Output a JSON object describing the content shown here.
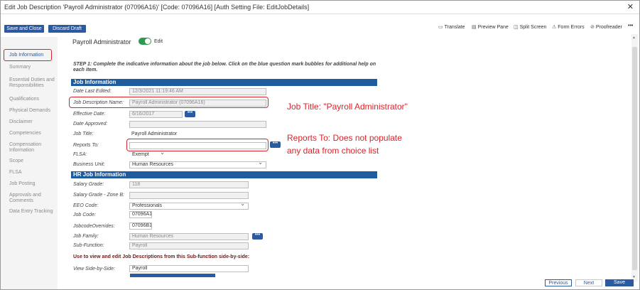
{
  "window": {
    "title": "Edit Job Description 'Payroll Administrator (07096A16)' [Code: 07096A16] [Auth Setting File: EditJobDetails]"
  },
  "toolbar": {
    "save_close": "Save and Close",
    "discard": "Discard Draft",
    "tools": [
      {
        "label": "Translate",
        "icon": "translate-icon"
      },
      {
        "label": "Preview Pane",
        "icon": "preview-icon"
      },
      {
        "label": "Split Screen",
        "icon": "split-screen-icon"
      },
      {
        "label": "Form Errors",
        "icon": "form-errors-icon"
      },
      {
        "label": "Proofreader",
        "icon": "proofreader-icon"
      }
    ],
    "more": "•••"
  },
  "sidebar": {
    "items": [
      "Job Information",
      "Summary",
      "Essential Duties and Responsibilities",
      "Qualifications",
      "Physical Demands",
      "Disclaimer",
      "Competencies",
      "Compensation Information",
      "Scope",
      "FLSA",
      "Job Posting",
      "Approvals and Comments",
      "Data Entry Tracking"
    ]
  },
  "header": {
    "job_name": "Payroll Administrator",
    "edit_label": "Edit"
  },
  "step_text": "STEP 1: Complete the indicative information about the job below. Click on the blue question mark bubbles for additional help on each item.",
  "sections": {
    "job_info": "Job Information",
    "hr_info": "HR Job Information"
  },
  "fields": {
    "date_last_edited": {
      "label": "Date Last Edited:",
      "value": "12/3/2021 11:19:46 AM"
    },
    "job_description_name": {
      "label": "Job Description Name:",
      "value": "Payroll Administrator (07096A16)"
    },
    "effective_date": {
      "label": "Effective Date:",
      "value": "6/16/2017"
    },
    "date_approved": {
      "label": "Date Approved:",
      "value": ""
    },
    "job_title": {
      "label": "Job Title:",
      "value": "Payroll Administrator"
    },
    "reports_to": {
      "label": "Reports To:",
      "value": ""
    },
    "flsa": {
      "label": "FLSA:",
      "value": "Exempt"
    },
    "business_unit": {
      "label": "Business Unit:",
      "value": "Human Resources"
    },
    "salary_grade": {
      "label": "Salary Grade:",
      "value": "118"
    },
    "salary_grade_zone_b": {
      "label": "Salary Grade - Zone B:",
      "value": ""
    },
    "eeo_code": {
      "label": "EEO Code:",
      "value": "Professionals"
    },
    "job_code": {
      "label": "Job Code:",
      "value": "07096A16"
    },
    "jobcode_overrides": {
      "label": "JobcodeOverrides:",
      "value": "07096B16"
    },
    "job_family": {
      "label": "Job Family:",
      "value": "Human Resources"
    },
    "sub_function": {
      "label": "Sub-Function:",
      "value": "Payroll"
    },
    "view_side_by_side": {
      "label": "View Side-by-Side:",
      "value": "Payroll"
    }
  },
  "subfunction_note": "Use to view and edit Job Descriptions from this Sub-function side-by-side:",
  "annotations": {
    "job_title": "Job Title: \"Payroll Administrator\"",
    "reports_to_line1": "Reports To: Does not populate",
    "reports_to_line2": "any data from choice list"
  },
  "footer": {
    "previous": "Previous",
    "next": "Next",
    "save": "Save"
  },
  "colors": {
    "accent": "#2c5aa0",
    "section_header": "#1f5c9e",
    "annotation_red": "#d9242c",
    "toggle_on": "#2e9a4f"
  }
}
